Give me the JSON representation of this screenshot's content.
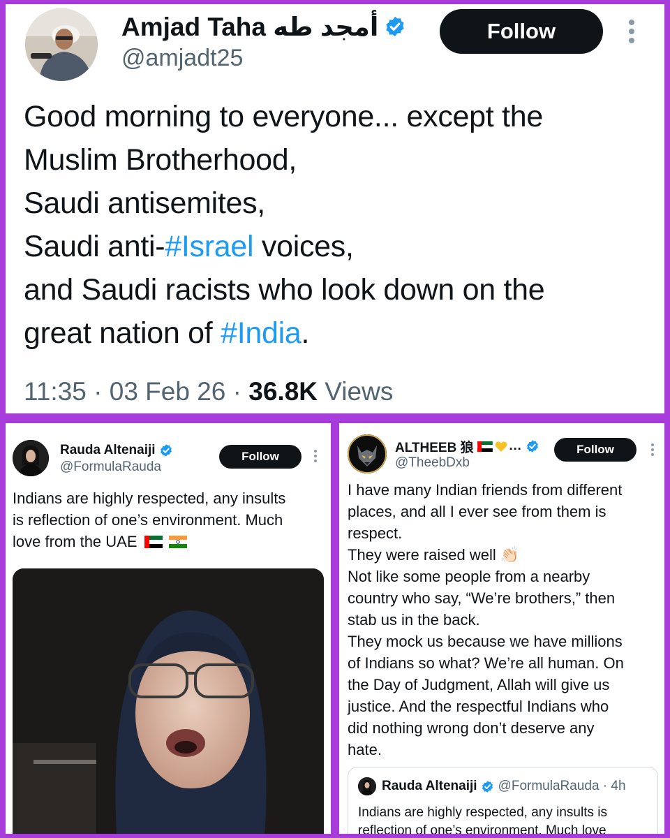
{
  "main_tweet": {
    "name": "Amjad Taha أمجد طه",
    "handle": "@amjadt25",
    "follow_label": "Follow",
    "lines": [
      [
        "Good morning to everyone... except the"
      ],
      [
        "Muslim Brotherhood,"
      ],
      [
        "Saudi antisemites,"
      ],
      [
        "Saudi anti-",
        "#Israel",
        " voices,"
      ],
      [
        "and Saudi racists who look down on the"
      ],
      [
        "great nation of ",
        "#India",
        "."
      ]
    ],
    "time": "11:35",
    "date": "03 Feb 26",
    "separator": "·",
    "views_count": "36.8K",
    "views_label": "Views"
  },
  "left_tweet": {
    "name": "Rauda Altenaiji",
    "handle": "@FormulaRauda",
    "follow_label": "Follow",
    "text": "Indians are highly respected, any insults\nis reflection of one’s environment. Much\nlove from the UAE",
    "flags": [
      "uae-flag",
      "india-flag"
    ]
  },
  "right_tweet": {
    "name": "ALTHEEB 狼",
    "name_suffix": "…",
    "handle": "@TheebDxb",
    "follow_label": "Follow",
    "text": "I have many Indian friends from different\nplaces, and all I ever see from them is\nrespect.\nThey were raised well 👏🏻\nNot like some people from a nearby\ncountry who say, “We’re brothers,” then\nstab us in the back.\nThey mock us because we have millions\nof Indians so what? We’re all human. On\nthe Day of Judgment, Allah will give us\njustice. And the respectful Indians who\ndid nothing wrong don’t deserve any\nhate.",
    "quote": {
      "name": "Rauda Altenaiji",
      "handle_time": "@FormulaRauda · 4h",
      "text": "Indians are highly respected, any insults is\nreflection of one’s environment. Much love"
    }
  },
  "colors": {
    "frame": "#a83cdb",
    "link": "#1d9bf0",
    "verified": "#1d9bf0",
    "secondary_text": "#536471",
    "button": "#0f1419"
  }
}
